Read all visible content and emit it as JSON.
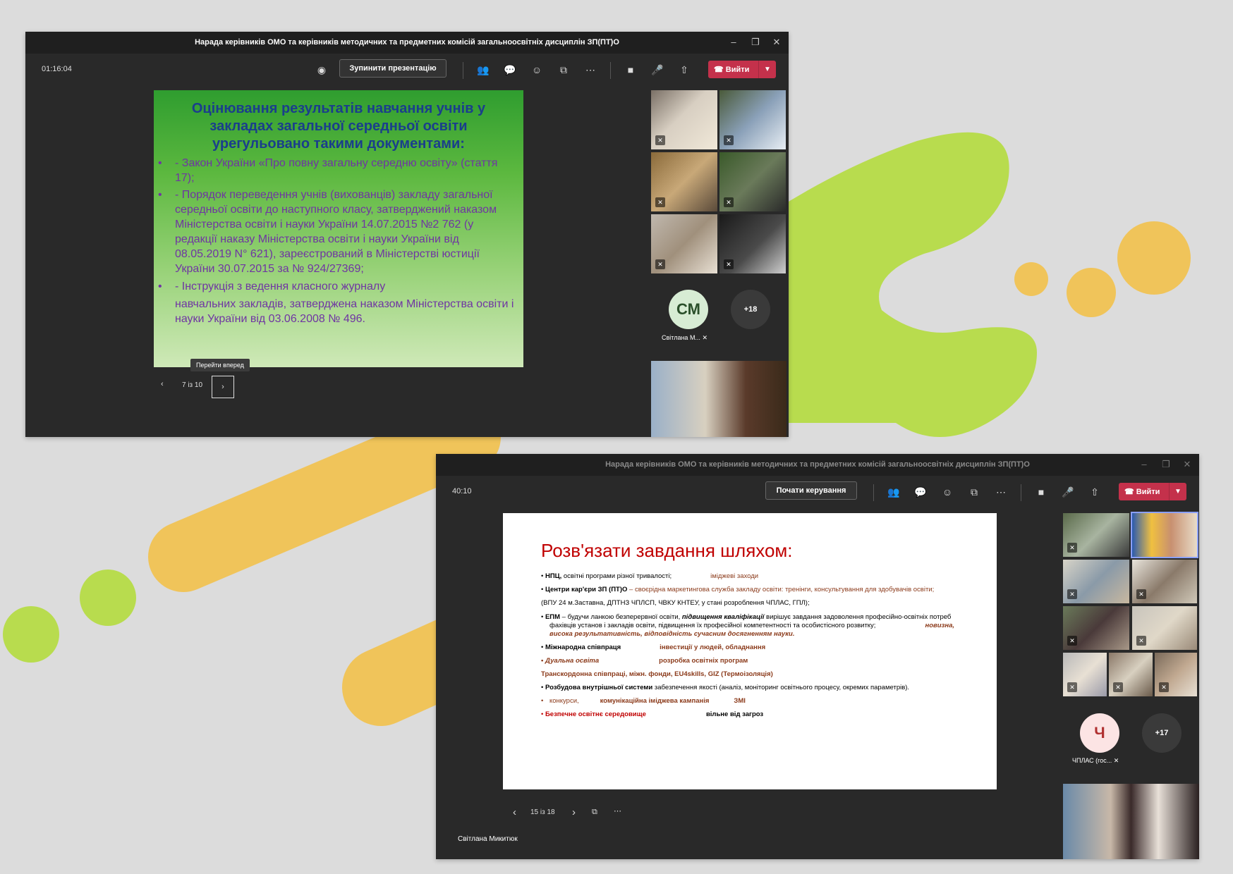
{
  "colors": {
    "lime": "#b8dc4e",
    "lime_dark": "#a6d23c",
    "yellow": "#f0c45a",
    "bg": "#dcdcdc",
    "teams_dark": "#292929",
    "leave_red": "#c4314b"
  },
  "win1": {
    "title": "Нарада керівників ОМО та керівників методичних та предметних комісій загальноосвітніх дисциплін ЗП(ПТ)О",
    "timer": "01:16:04",
    "stop_presenting": "Зупинити презентацію",
    "leave_label": "Вийти",
    "slide": {
      "title": "Оцінювання результатів навчання учнів у закладах загальної середньої освіти урегульовано такими документами:",
      "bullets": [
        {
          "dot": "•",
          "text": "- Закон України «Про повну загальну середню освіту» (стаття 17);"
        },
        {
          "dot": "•",
          "text": "- Порядок переведення учнів (вихованців) закладу загальної середньої освіти до наступного класу, затверджений наказом Міністерства освіти і науки України 14.07.2015 №2 762 (у редакції наказу Міністерства освіти і науки України від 08.05.2019 N° 621), зареєстрований в Міністерстві юстиції України 30.07.2015 за № 924/27369;"
        },
        {
          "dot": "•",
          "text": "- Інструкція з ведення класного журналу"
        },
        {
          "dot": "",
          "text": "навчальних закладів, затверджена наказом Міністерства освіти і науки України від 03.06.2008 № 496."
        }
      ]
    },
    "tooltip": "Перейти вперед",
    "page_counter": "7 із 10",
    "avatar_initials": "СМ",
    "avatar_name": "Світлана М...",
    "more_count": "+18",
    "icons": [
      "eye-icon",
      "people-icon",
      "chat-icon",
      "reactions-icon",
      "rooms-icon",
      "more-icon",
      "camera-icon",
      "mic-icon",
      "share-icon",
      "phone-icon",
      "chevron-down-icon",
      "minimize-icon",
      "maximize-icon",
      "close-icon",
      "chevron-left-icon",
      "chevron-right-icon",
      "mic-off-icon"
    ]
  },
  "win2": {
    "title": "Нарада керівників ОМО та керівників методичних та предметних комісій загальноосвітніх дисциплін ЗП(ПТ)О",
    "timer": "40:10",
    "take_control": "Почати керування",
    "leave_label": "Вийти",
    "slide": {
      "title": "Розв'язати завдання шляхом:",
      "l1a": "НПЦ,",
      "l1b": "освітні програми різної тривалості;",
      "l1c": "іміджеві заходи",
      "l2a": "Центри кар'єри ЗП (ПТ)О",
      "l2b": " – своєрідна маркетингова служба закладу освіти: тренінги, консультування для здобувачів освіти;",
      "l3": "(ВПУ 24 м.Заставна, ДПТНЗ ЧПЛСП, ЧВКУ КНТЕУ, у стані розроблення ЧПЛАС, ГПЛ);",
      "l4a": "ЕПМ",
      "l4b": " – будучи ланкою безперервної освіти, ",
      "l4c": "підвищення кваліфікації",
      "l4d": " вирішує завдання задоволення професійно-освітніх потреб",
      "l5a": "фахівців установ і закладів освіти, підвищення їх професійної компетентності та особистісного розвитку;",
      "l5b": "новизна,",
      "l6": "висока результативність, відповідність сучасним досягненням науки.",
      "l7a": "Міжнародна співпраця",
      "l7b": "інвестиції у людей, обладнання",
      "l8a": "Дуальна освіта",
      "l8b": "розробка освітніх програм",
      "l9": "Транскордонна співпраці, міжн. фонди, EU4skills, GIZ (Термоізоляція)",
      "l10a": "Розбудова внутрішньої системи",
      "l10b": " забезпечення якості (аналіз, моніторинг освітнього процесу, окремих параметрів).",
      "l11a": "конкурси,",
      "l11b": "комунікаційна іміджева кампанія",
      "l11c": "ЗМІ",
      "l12a": "Безпечне освітнє середовище",
      "l12b": "вільне від загроз"
    },
    "page_counter": "15 із 18",
    "presenter": "Світлана Микитюк",
    "avatar_initials": "Ч",
    "avatar_name": "ЧПЛАС (гос...",
    "more_count": "+17"
  }
}
